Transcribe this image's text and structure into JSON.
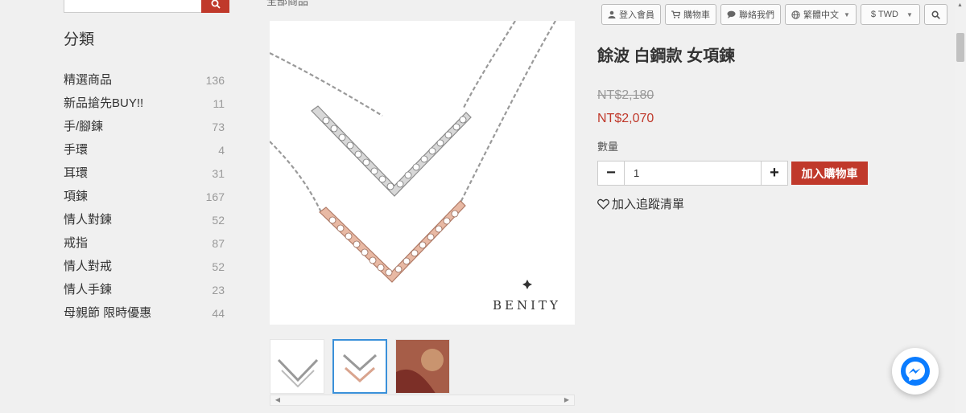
{
  "breadcrumb": "全部商品",
  "sidebar": {
    "title": "分類",
    "items": [
      {
        "label": "精選商品",
        "count": "136"
      },
      {
        "label": "新品搶先BUY!!",
        "count": "11"
      },
      {
        "label": "手/腳鍊",
        "count": "73"
      },
      {
        "label": "手環",
        "count": "4"
      },
      {
        "label": "耳環",
        "count": "31"
      },
      {
        "label": "項鍊",
        "count": "167"
      },
      {
        "label": "情人對鍊",
        "count": "52"
      },
      {
        "label": "戒指",
        "count": "87"
      },
      {
        "label": "情人對戒",
        "count": "52"
      },
      {
        "label": "情人手鍊",
        "count": "23"
      },
      {
        "label": "母親節 限時優惠",
        "count": "44"
      }
    ]
  },
  "nav": {
    "login": "登入會員",
    "cart": "購物車",
    "contact": "聯絡我們",
    "language": "繁體中文",
    "currency": "$ TWD"
  },
  "product": {
    "title": "餘波 白鋼款 女項鍊",
    "price_old": "NT$2,180",
    "price_new": "NT$2,070",
    "qty_label": "數量",
    "qty_value": "1",
    "add_to_cart": "加入購物車",
    "wishlist": "加入追蹤清單",
    "brand": "BENITY"
  },
  "colors": {
    "accent": "#c0392b",
    "thumb_active": "#3a90d9",
    "messenger": "#0a7cff"
  },
  "icons": [
    "search-icon",
    "user-icon",
    "cart-icon",
    "chat-icon",
    "globe-icon",
    "heart-icon",
    "messenger-icon"
  ]
}
